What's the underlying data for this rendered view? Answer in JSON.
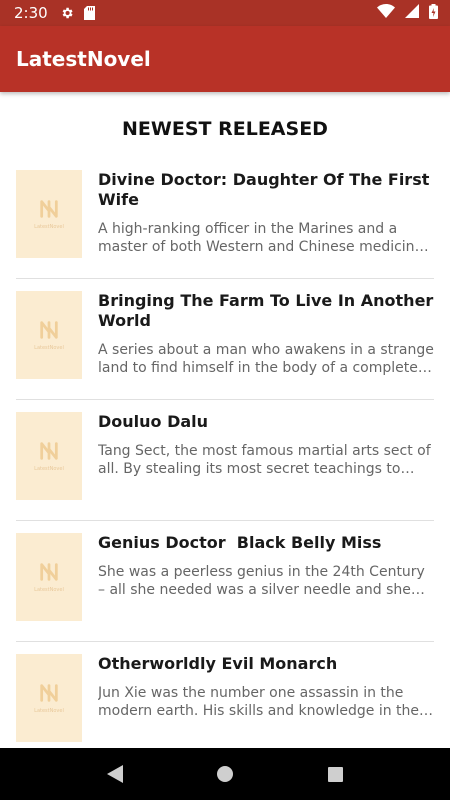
{
  "status_bar": {
    "time": "2:30",
    "icons_left": [
      "gear-icon",
      "sd-card-icon"
    ],
    "icons_right": [
      "wifi-icon",
      "cell-signal-icon",
      "battery-icon"
    ]
  },
  "app_bar": {
    "title": "LatestNovel",
    "color": "#b83227"
  },
  "section": {
    "title": "NEWEST RELEASED"
  },
  "cover_label": "LatestNovel",
  "novels": [
    {
      "title": "Divine Doctor: Daughter Of The First Wife",
      "description": "A high-ranking officer in the Marines and a master of both Western and Chinese medicine, …"
    },
    {
      "title": "Bringing The Farm To Live In Another World",
      "description": "A series about a man who awakens in a strange land to find himself in the body of a complete w…"
    },
    {
      "title": "Douluo Dalu",
      "description": "Tang Sect, the most famous martial arts sect of all. By stealing its most secret teachings to fulfi…"
    },
    {
      "title": "Genius Doctor  Black Belly Miss",
      "description": "She was a peerless genius in the 24th Century – all she needed was a silver needle and she coul…"
    },
    {
      "title": "Otherworldly Evil Monarch",
      "description": "Jun Xie was the number one assassin in the modern earth. His skills and knowledge in the fi…"
    }
  ],
  "nav_bar": {
    "buttons": [
      "back-icon",
      "home-icon",
      "recents-icon"
    ]
  }
}
